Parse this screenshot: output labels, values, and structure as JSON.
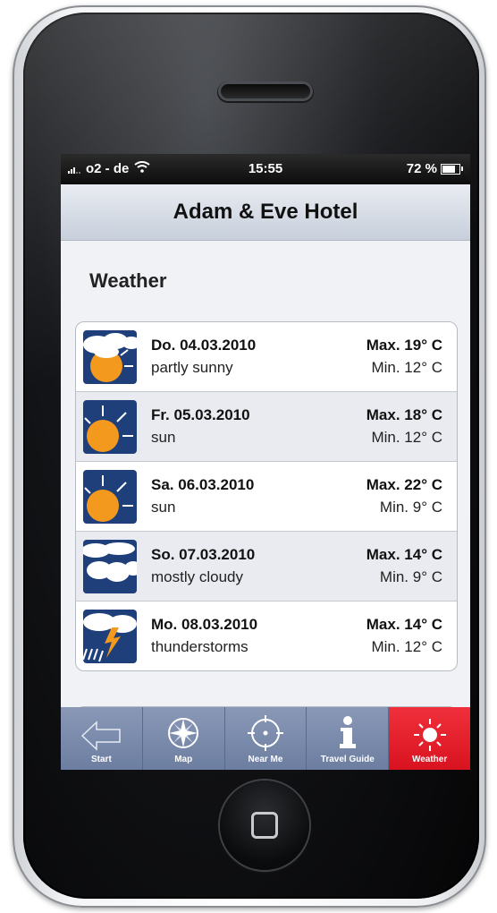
{
  "statusbar": {
    "carrier": "o2 - de",
    "time": "15:55",
    "battery": "72 %"
  },
  "header": {
    "title": "Adam & Eve Hotel"
  },
  "section": {
    "title": "Weather"
  },
  "forecast": [
    {
      "date": "Do. 04.03.2010",
      "condition": "partly sunny",
      "max": "Max. 19° C",
      "min": "Min. 12° C",
      "icon": "partly-sunny-icon"
    },
    {
      "date": "Fr. 05.03.2010",
      "condition": "sun",
      "max": "Max. 18° C",
      "min": "Min. 12° C",
      "icon": "sun-icon"
    },
    {
      "date": "Sa. 06.03.2010",
      "condition": "sun",
      "max": "Max. 22° C",
      "min": "Min. 9° C",
      "icon": "sun-icon"
    },
    {
      "date": "So. 07.03.2010",
      "condition": "mostly cloudy",
      "max": "Max. 14° C",
      "min": "Min. 9° C",
      "icon": "cloudy-icon"
    },
    {
      "date": "Mo. 08.03.2010",
      "condition": "thunderstorms",
      "max": "Max. 14° C",
      "min": "Min. 12° C",
      "icon": "thunderstorm-icon"
    }
  ],
  "tabs": [
    {
      "label": "Start",
      "icon": "back-arrow-icon"
    },
    {
      "label": "Map",
      "icon": "compass-icon"
    },
    {
      "label": "Near Me",
      "icon": "target-icon"
    },
    {
      "label": "Travel Guide",
      "icon": "info-icon"
    },
    {
      "label": "Weather",
      "icon": "weather-sun-icon",
      "active": true
    }
  ],
  "colors": {
    "icon_bg": "#1f3f7a",
    "sun": "#f39a1e",
    "tab_bg": "#7484a6",
    "tab_active": "#e51d28"
  }
}
